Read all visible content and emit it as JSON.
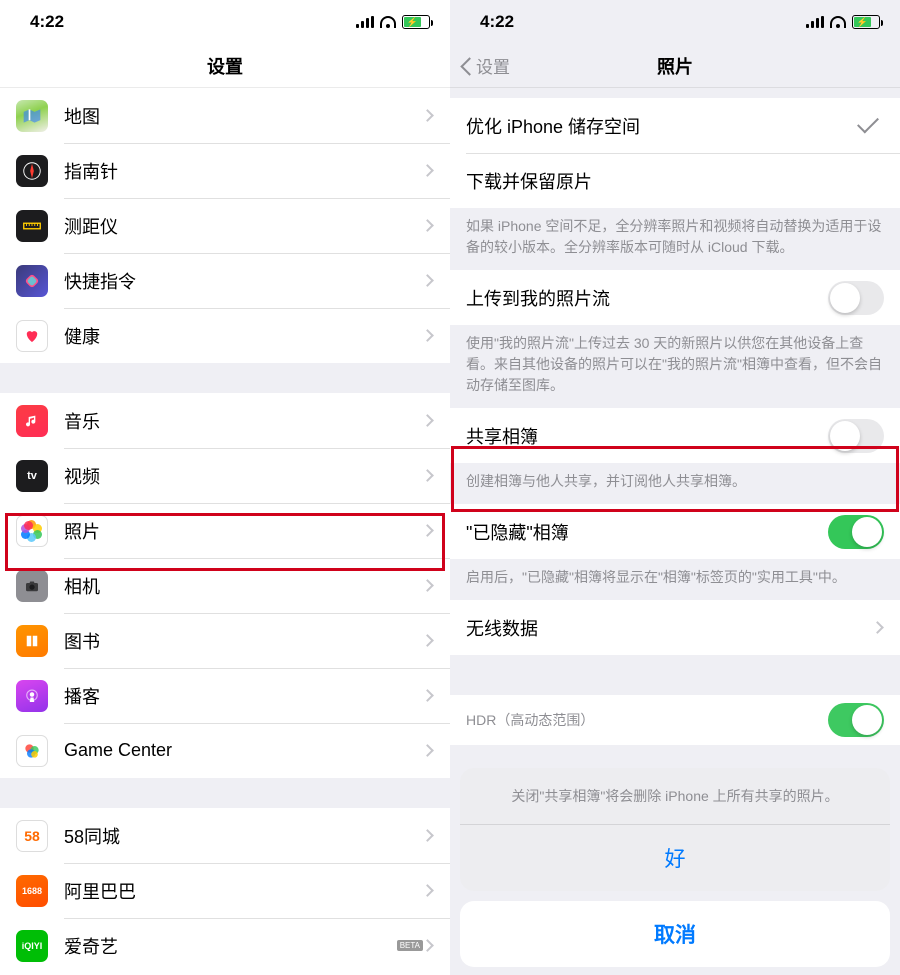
{
  "status": {
    "time": "4:22",
    "battery_pct": 70
  },
  "left": {
    "title": "设置",
    "groups": [
      {
        "rows": [
          {
            "id": "maps",
            "label": "地图",
            "icon": "ic-maps"
          },
          {
            "id": "compass",
            "label": "指南针",
            "icon": "ic-compass"
          },
          {
            "id": "measure",
            "label": "测距仪",
            "icon": "ic-measure"
          },
          {
            "id": "shortcuts",
            "label": "快捷指令",
            "icon": "ic-shortcuts"
          },
          {
            "id": "health",
            "label": "健康",
            "icon": "ic-health"
          }
        ]
      },
      {
        "rows": [
          {
            "id": "music",
            "label": "音乐",
            "icon": "ic-music"
          },
          {
            "id": "tv",
            "label": "视频",
            "icon": "ic-tv"
          },
          {
            "id": "photos",
            "label": "照片",
            "icon": "ic-photos",
            "highlight": true
          },
          {
            "id": "camera",
            "label": "相机",
            "icon": "ic-camera"
          },
          {
            "id": "books",
            "label": "图书",
            "icon": "ic-books"
          },
          {
            "id": "podcasts",
            "label": "播客",
            "icon": "ic-podcasts"
          },
          {
            "id": "gamecenter",
            "label": "Game Center",
            "icon": "ic-gamecenter"
          }
        ]
      },
      {
        "rows": [
          {
            "id": "app-58",
            "label": "58同城",
            "icon": "ic-58"
          },
          {
            "id": "app-alibaba",
            "label": "阿里巴巴",
            "icon": "ic-alibaba"
          },
          {
            "id": "app-iqiyi",
            "label": "爱奇艺",
            "icon": "ic-iqiyi",
            "beta_mark": "BETA"
          }
        ]
      }
    ]
  },
  "right": {
    "back": "设置",
    "title": "照片",
    "optimize_label": "优化 iPhone 储存空间",
    "download_label": "下载并保留原片",
    "storage_footer": "如果 iPhone 空间不足，全分辨率照片和视频将自动替换为适用于设备的较小版本。全分辨率版本可随时从 iCloud 下载。",
    "photostream_label": "上传到我的照片流",
    "photostream_on": false,
    "photostream_footer": "使用\"我的照片流\"上传过去 30 天的新照片以供您在其他设备上查看。来自其他设备的照片可以在\"我的照片流\"相簿中查看，但不会自动存储至图库。",
    "shared_label": "共享相簿",
    "shared_on": false,
    "shared_footer": "创建相簿与他人共享，并订阅他人共享相簿。",
    "hidden_label": "\"已隐藏\"相簿",
    "hidden_on": true,
    "hidden_footer": "启用后，\"已隐藏\"相簿将显示在\"相簿\"标签页的\"实用工具\"中。",
    "cellular_label": "无线数据",
    "hdr_header": "HDR（高动态范围）",
    "sheet": {
      "message": "关闭\"共享相簿\"将会删除 iPhone 上所有共享的照片。",
      "ok": "好",
      "cancel": "取消"
    }
  }
}
